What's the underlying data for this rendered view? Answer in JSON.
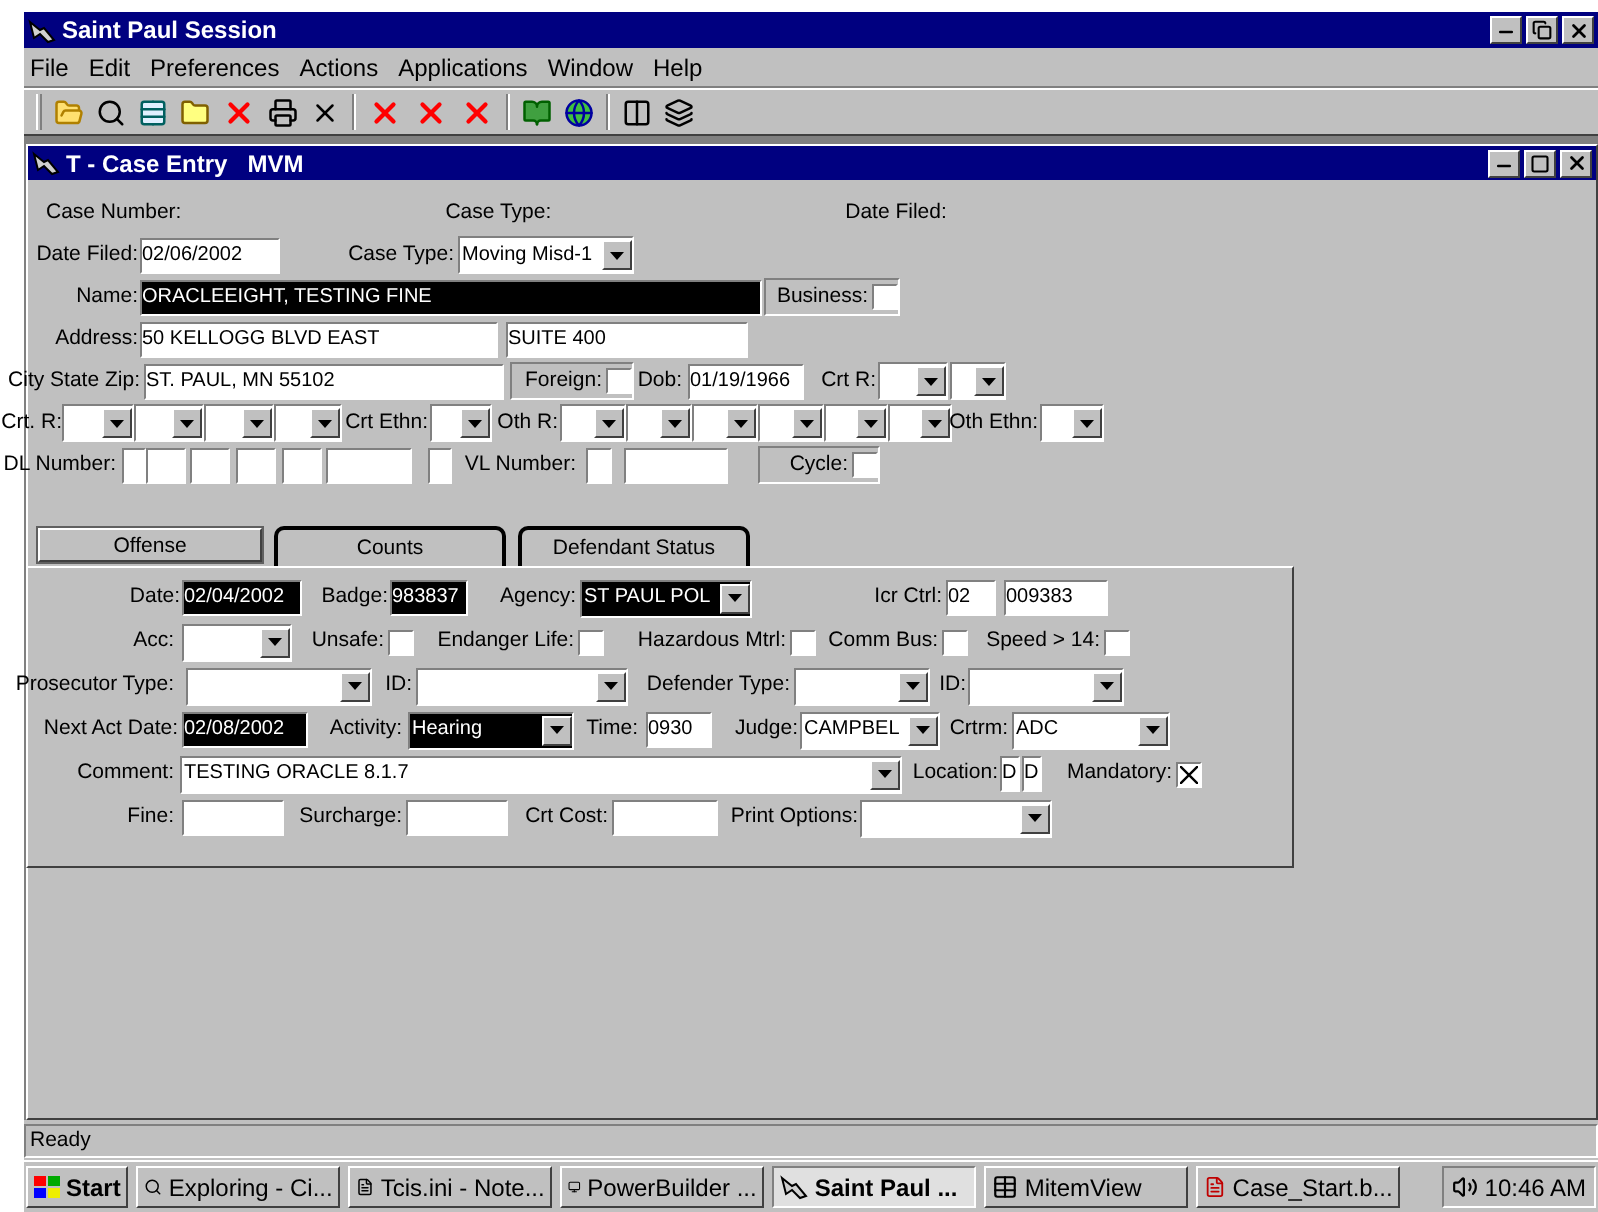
{
  "window": {
    "title": "Saint Paul Session"
  },
  "menu": [
    "File",
    "Edit",
    "Preferences",
    "Actions",
    "Applications",
    "Window",
    "Help"
  ],
  "child_window": {
    "title": "T - Case Entry   MVM"
  },
  "header_labels": [
    "Case Number:",
    "Case Type:",
    "Date Filed:"
  ],
  "form_rows": [
    [
      {
        "kind": "label",
        "text": "Date Filed:"
      },
      {
        "kind": "text",
        "value": "02/06/2002",
        "highlighted": false
      },
      {
        "kind": "label",
        "text": "Case Type:"
      },
      {
        "kind": "combo",
        "value": "Moving Misd-1",
        "highlighted": false
      }
    ],
    [
      {
        "kind": "label",
        "text": "Name:"
      },
      {
        "kind": "text",
        "value": "ORACLEEIGHT, TESTING FINE",
        "highlighted": true
      },
      {
        "kind": "check",
        "label": "Business:",
        "checked": false
      }
    ],
    [
      {
        "kind": "label",
        "text": "Address:"
      },
      {
        "kind": "text",
        "value": "50 KELLOGG BLVD EAST",
        "highlighted": false
      },
      {
        "kind": "text",
        "value": "SUITE 400",
        "highlighted": false
      }
    ],
    [
      {
        "kind": "label",
        "text": "City State Zip:"
      },
      {
        "kind": "text",
        "value": "ST. PAUL, MN 55102",
        "highlighted": false
      },
      {
        "kind": "check",
        "label": "Foreign:",
        "checked": false
      },
      {
        "kind": "label",
        "text": "Dob:"
      },
      {
        "kind": "text",
        "value": "01/19/1966",
        "highlighted": false
      },
      {
        "kind": "label",
        "text": "Crt R:"
      },
      {
        "kind": "combo",
        "highlighted": false
      },
      {
        "kind": "combo",
        "highlighted": false
      }
    ],
    [
      {
        "kind": "label",
        "text": "Crt. R:"
      },
      {
        "kind": "combo",
        "highlighted": false
      },
      {
        "kind": "combo",
        "highlighted": false
      },
      {
        "kind": "combo",
        "highlighted": false
      },
      {
        "kind": "combo",
        "highlighted": false
      },
      {
        "kind": "label",
        "text": "Crt Ethn:"
      },
      {
        "kind": "combo",
        "highlighted": false
      },
      {
        "kind": "label",
        "text": "Oth R:"
      },
      {
        "kind": "combo",
        "highlighted": false
      },
      {
        "kind": "combo",
        "highlighted": false
      },
      {
        "kind": "combo",
        "highlighted": false
      },
      {
        "kind": "combo",
        "highlighted": false
      },
      {
        "kind": "combo",
        "highlighted": false
      },
      {
        "kind": "combo",
        "highlighted": false
      },
      {
        "kind": "label",
        "text": "Oth Ethn:"
      },
      {
        "kind": "combo",
        "highlighted": false
      }
    ],
    [
      {
        "kind": "label",
        "text": "DL Number:"
      },
      {
        "kind": "text",
        "highlighted": false
      },
      {
        "kind": "text",
        "highlighted": false
      },
      {
        "kind": "text",
        "highlighted": false
      },
      {
        "kind": "text",
        "highlighted": false
      },
      {
        "kind": "text",
        "highlighted": false
      },
      {
        "kind": "text",
        "highlighted": false
      },
      {
        "kind": "text",
        "highlighted": false
      },
      {
        "kind": "label",
        "text": "VL Number:"
      },
      {
        "kind": "text",
        "highlighted": false
      },
      {
        "kind": "text",
        "highlighted": false
      },
      {
        "kind": "check",
        "label": "Cycle:",
        "checked": false
      }
    ]
  ],
  "tabs": [
    {
      "label": "Offense",
      "selected": true
    },
    {
      "label": "Counts",
      "selected": false
    },
    {
      "label": "Defendant Status",
      "selected": false
    }
  ],
  "offense_rows": [
    [
      {
        "kind": "label",
        "text": "Date:"
      },
      {
        "kind": "text",
        "value": "02/04/2002",
        "highlighted": true
      },
      {
        "kind": "label",
        "text": "Badge:"
      },
      {
        "kind": "text",
        "value": "983837",
        "highlighted": true
      },
      {
        "kind": "label",
        "text": "Agency:"
      },
      {
        "kind": "combo",
        "value": "ST PAUL POL",
        "highlighted": true
      },
      {
        "kind": "label",
        "text": "Icr Ctrl:"
      },
      {
        "kind": "text",
        "value": "02",
        "highlighted": false
      },
      {
        "kind": "text",
        "value": "009383",
        "highlighted": false
      }
    ],
    [
      {
        "kind": "label",
        "text": "Acc:"
      },
      {
        "kind": "combo",
        "highlighted": false
      },
      {
        "kind": "check",
        "label": "Unsafe:",
        "checked": false
      },
      {
        "kind": "check",
        "label": "Endanger Life:",
        "checked": false
      },
      {
        "kind": "check",
        "label": "Hazardous Mtrl:",
        "checked": false
      },
      {
        "kind": "check",
        "label": "Comm Bus:",
        "checked": false
      },
      {
        "kind": "check",
        "label": "Speed > 14:",
        "checked": false
      }
    ],
    [
      {
        "kind": "label",
        "text": "Prosecutor Type:"
      },
      {
        "kind": "combo",
        "highlighted": false
      },
      {
        "kind": "label",
        "text": "ID:"
      },
      {
        "kind": "combo",
        "highlighted": false
      },
      {
        "kind": "label",
        "text": "Defender Type:"
      },
      {
        "kind": "combo",
        "highlighted": false
      },
      {
        "kind": "label",
        "text": "ID:"
      },
      {
        "kind": "combo",
        "highlighted": false
      }
    ],
    [
      {
        "kind": "label",
        "text": "Next Act Date:"
      },
      {
        "kind": "text",
        "value": "02/08/2002",
        "highlighted": true
      },
      {
        "kind": "label",
        "text": "Activity:"
      },
      {
        "kind": "combo",
        "value": "Hearing",
        "highlighted": true
      },
      {
        "kind": "label",
        "text": "Time:"
      },
      {
        "kind": "text",
        "value": "0930",
        "highlighted": false
      },
      {
        "kind": "label",
        "text": "Judge:"
      },
      {
        "kind": "combo",
        "value": "CAMPBEL",
        "highlighted": false
      },
      {
        "kind": "label",
        "text": "Crtrm:"
      },
      {
        "kind": "combo",
        "value": "ADC",
        "highlighted": false
      }
    ],
    [
      {
        "kind": "label",
        "text": "Comment:"
      },
      {
        "kind": "combo",
        "value": "TESTING ORACLE 8.1.7",
        "highlighted": false
      },
      {
        "kind": "label",
        "text": "Location:"
      },
      {
        "kind": "text",
        "value": "D",
        "highlighted": false
      },
      {
        "kind": "text",
        "value": "D",
        "highlighted": false
      },
      {
        "kind": "check",
        "label": "Mandatory:",
        "checked": true
      }
    ],
    [
      {
        "kind": "label",
        "text": "Fine:"
      },
      {
        "kind": "text",
        "highlighted": false
      },
      {
        "kind": "label",
        "text": "Surcharge:"
      },
      {
        "kind": "text",
        "highlighted": false
      },
      {
        "kind": "label",
        "text": "Crt Cost:"
      },
      {
        "kind": "text",
        "highlighted": false
      },
      {
        "kind": "label",
        "text": "Print Options:"
      },
      {
        "kind": "combo",
        "highlighted": false
      }
    ]
  ],
  "status_bar": "Ready",
  "taskbar": {
    "start": "Start",
    "items": [
      {
        "label": "Exploring - Ci...",
        "selected": false
      },
      {
        "label": "Tcis.ini - Note...",
        "selected": false
      },
      {
        "label": "PowerBuilder ...",
        "selected": false
      },
      {
        "label": "Saint Paul ...",
        "selected": true
      },
      {
        "label": "MitemView",
        "selected": false
      },
      {
        "label": "Case_Start.b...",
        "selected": false
      }
    ],
    "clock": "10:46 AM"
  }
}
